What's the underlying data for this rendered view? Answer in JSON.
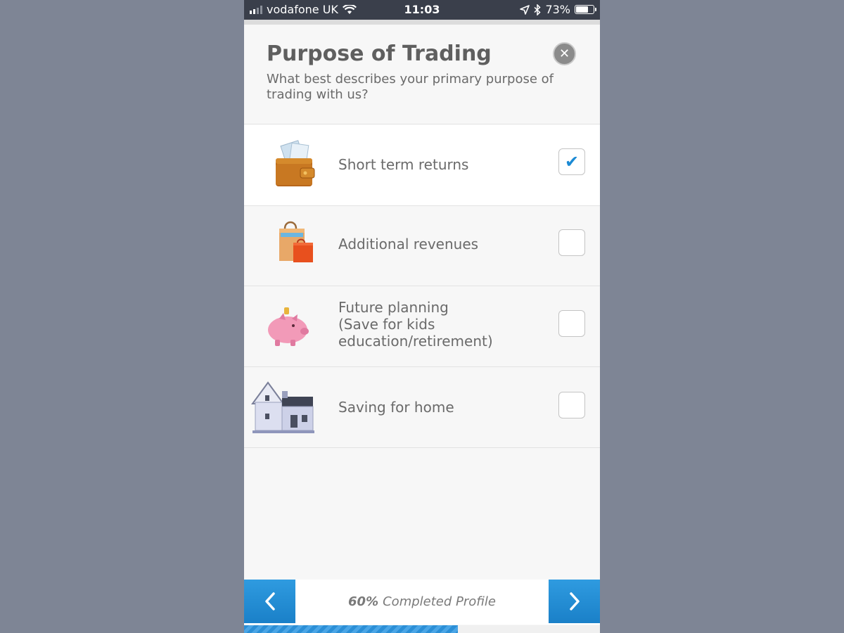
{
  "status_bar": {
    "carrier": "vodafone UK",
    "time": "11:03",
    "battery": "73%",
    "battery_level": 0.73
  },
  "header": {
    "title": "Purpose of Trading",
    "subtitle": "What best describes your primary purpose of trading with us?",
    "close_icon": "close-icon"
  },
  "options": [
    {
      "label_lines": [
        "Short term returns"
      ],
      "icon": "wallet-icon",
      "checked": true
    },
    {
      "label_lines": [
        "Additional revenues"
      ],
      "icon": "shopping-bags-icon",
      "checked": false
    },
    {
      "label_lines": [
        "Future planning",
        "(Save for kids",
        "education/retirement)"
      ],
      "icon": "piggy-bank-icon",
      "checked": false
    },
    {
      "label_lines": [
        "Saving for home"
      ],
      "icon": "house-icon",
      "checked": false
    }
  ],
  "footer": {
    "progress_percent": "60%",
    "progress_label": "Completed Profile",
    "progress_value": 0.6,
    "prev_icon": "chevron-left-icon",
    "next_icon": "chevron-right-icon"
  },
  "colors": {
    "accent": "#1b8ad4",
    "background": "#7e8595",
    "status_bar": "#3a3f4b"
  }
}
